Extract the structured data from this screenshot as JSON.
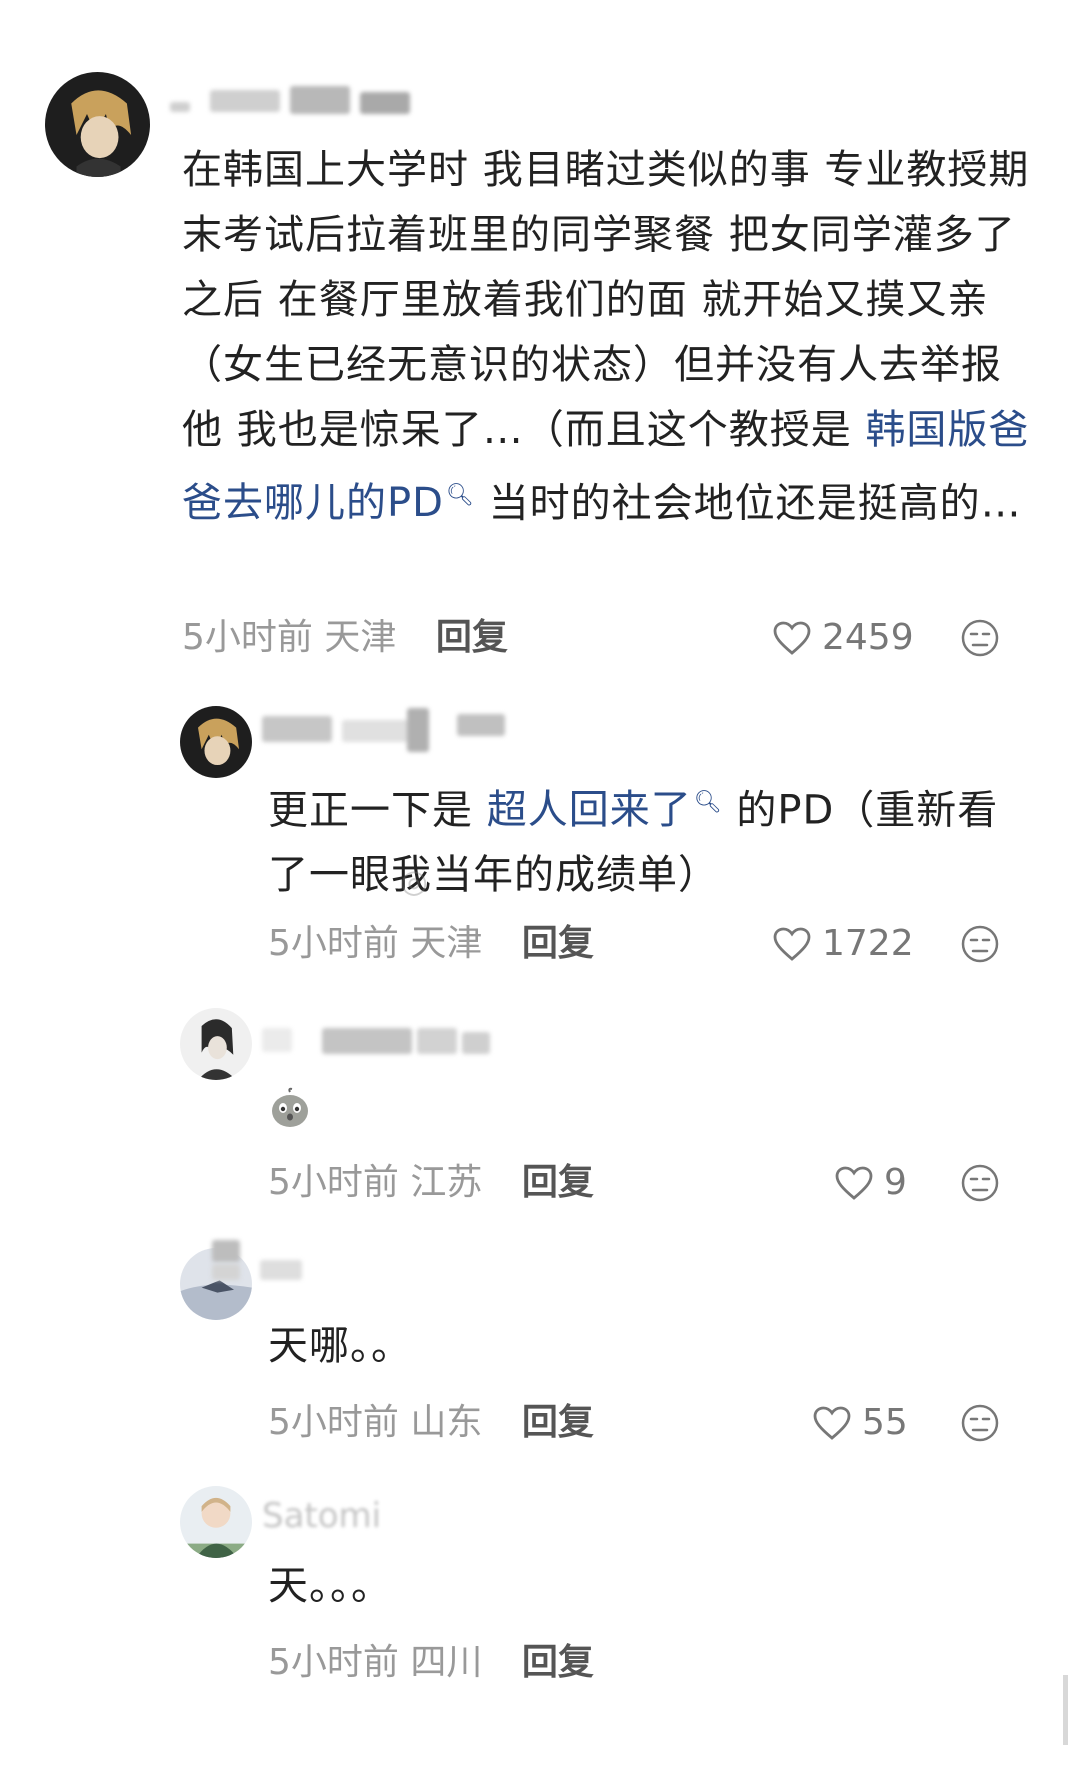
{
  "comments": [
    {
      "body_parts": [
        "在韩国上大学时 我目睹过类似的事 专业教授期末考试后拉着班里的同学聚餐 把女同学灌多了之后 在餐厅里放着我们的面 就开始又摸又亲（女生已经无意识的状态）但并没有人去举报他 我也是惊呆了…（而且这个教授是 ",
        "韩国版爸爸去哪儿的PD",
        " 当时的社会地位还是挺高的…"
      ],
      "time": "5小时前",
      "location": "天津",
      "reply_label": "回复",
      "likes": "2459"
    },
    {
      "body_parts": [
        "更正一下是 ",
        "超人回来了",
        " 的PD（重新看了一眼我当年的成绩单）"
      ],
      "time": "5小时前",
      "location": "天津",
      "reply_label": "回复",
      "likes": "1722"
    },
    {
      "emoji": "shocked-chick-emoji",
      "time": "5小时前",
      "location": "江苏",
      "reply_label": "回复",
      "likes": "9"
    },
    {
      "body": "天哪。。",
      "time": "5小时前",
      "location": "山东",
      "reply_label": "回复",
      "likes": "55"
    },
    {
      "username": "Satomi",
      "body": "天。。。",
      "time": "5小时前",
      "location": "四川",
      "reply_label": "回复"
    }
  ],
  "icons": {
    "like": "heart-outline-icon",
    "dislike": "neutral-face-icon",
    "search": "search-icon"
  },
  "colors": {
    "link": "#2b4d8a",
    "meta": "#999999",
    "text": "#222222"
  }
}
